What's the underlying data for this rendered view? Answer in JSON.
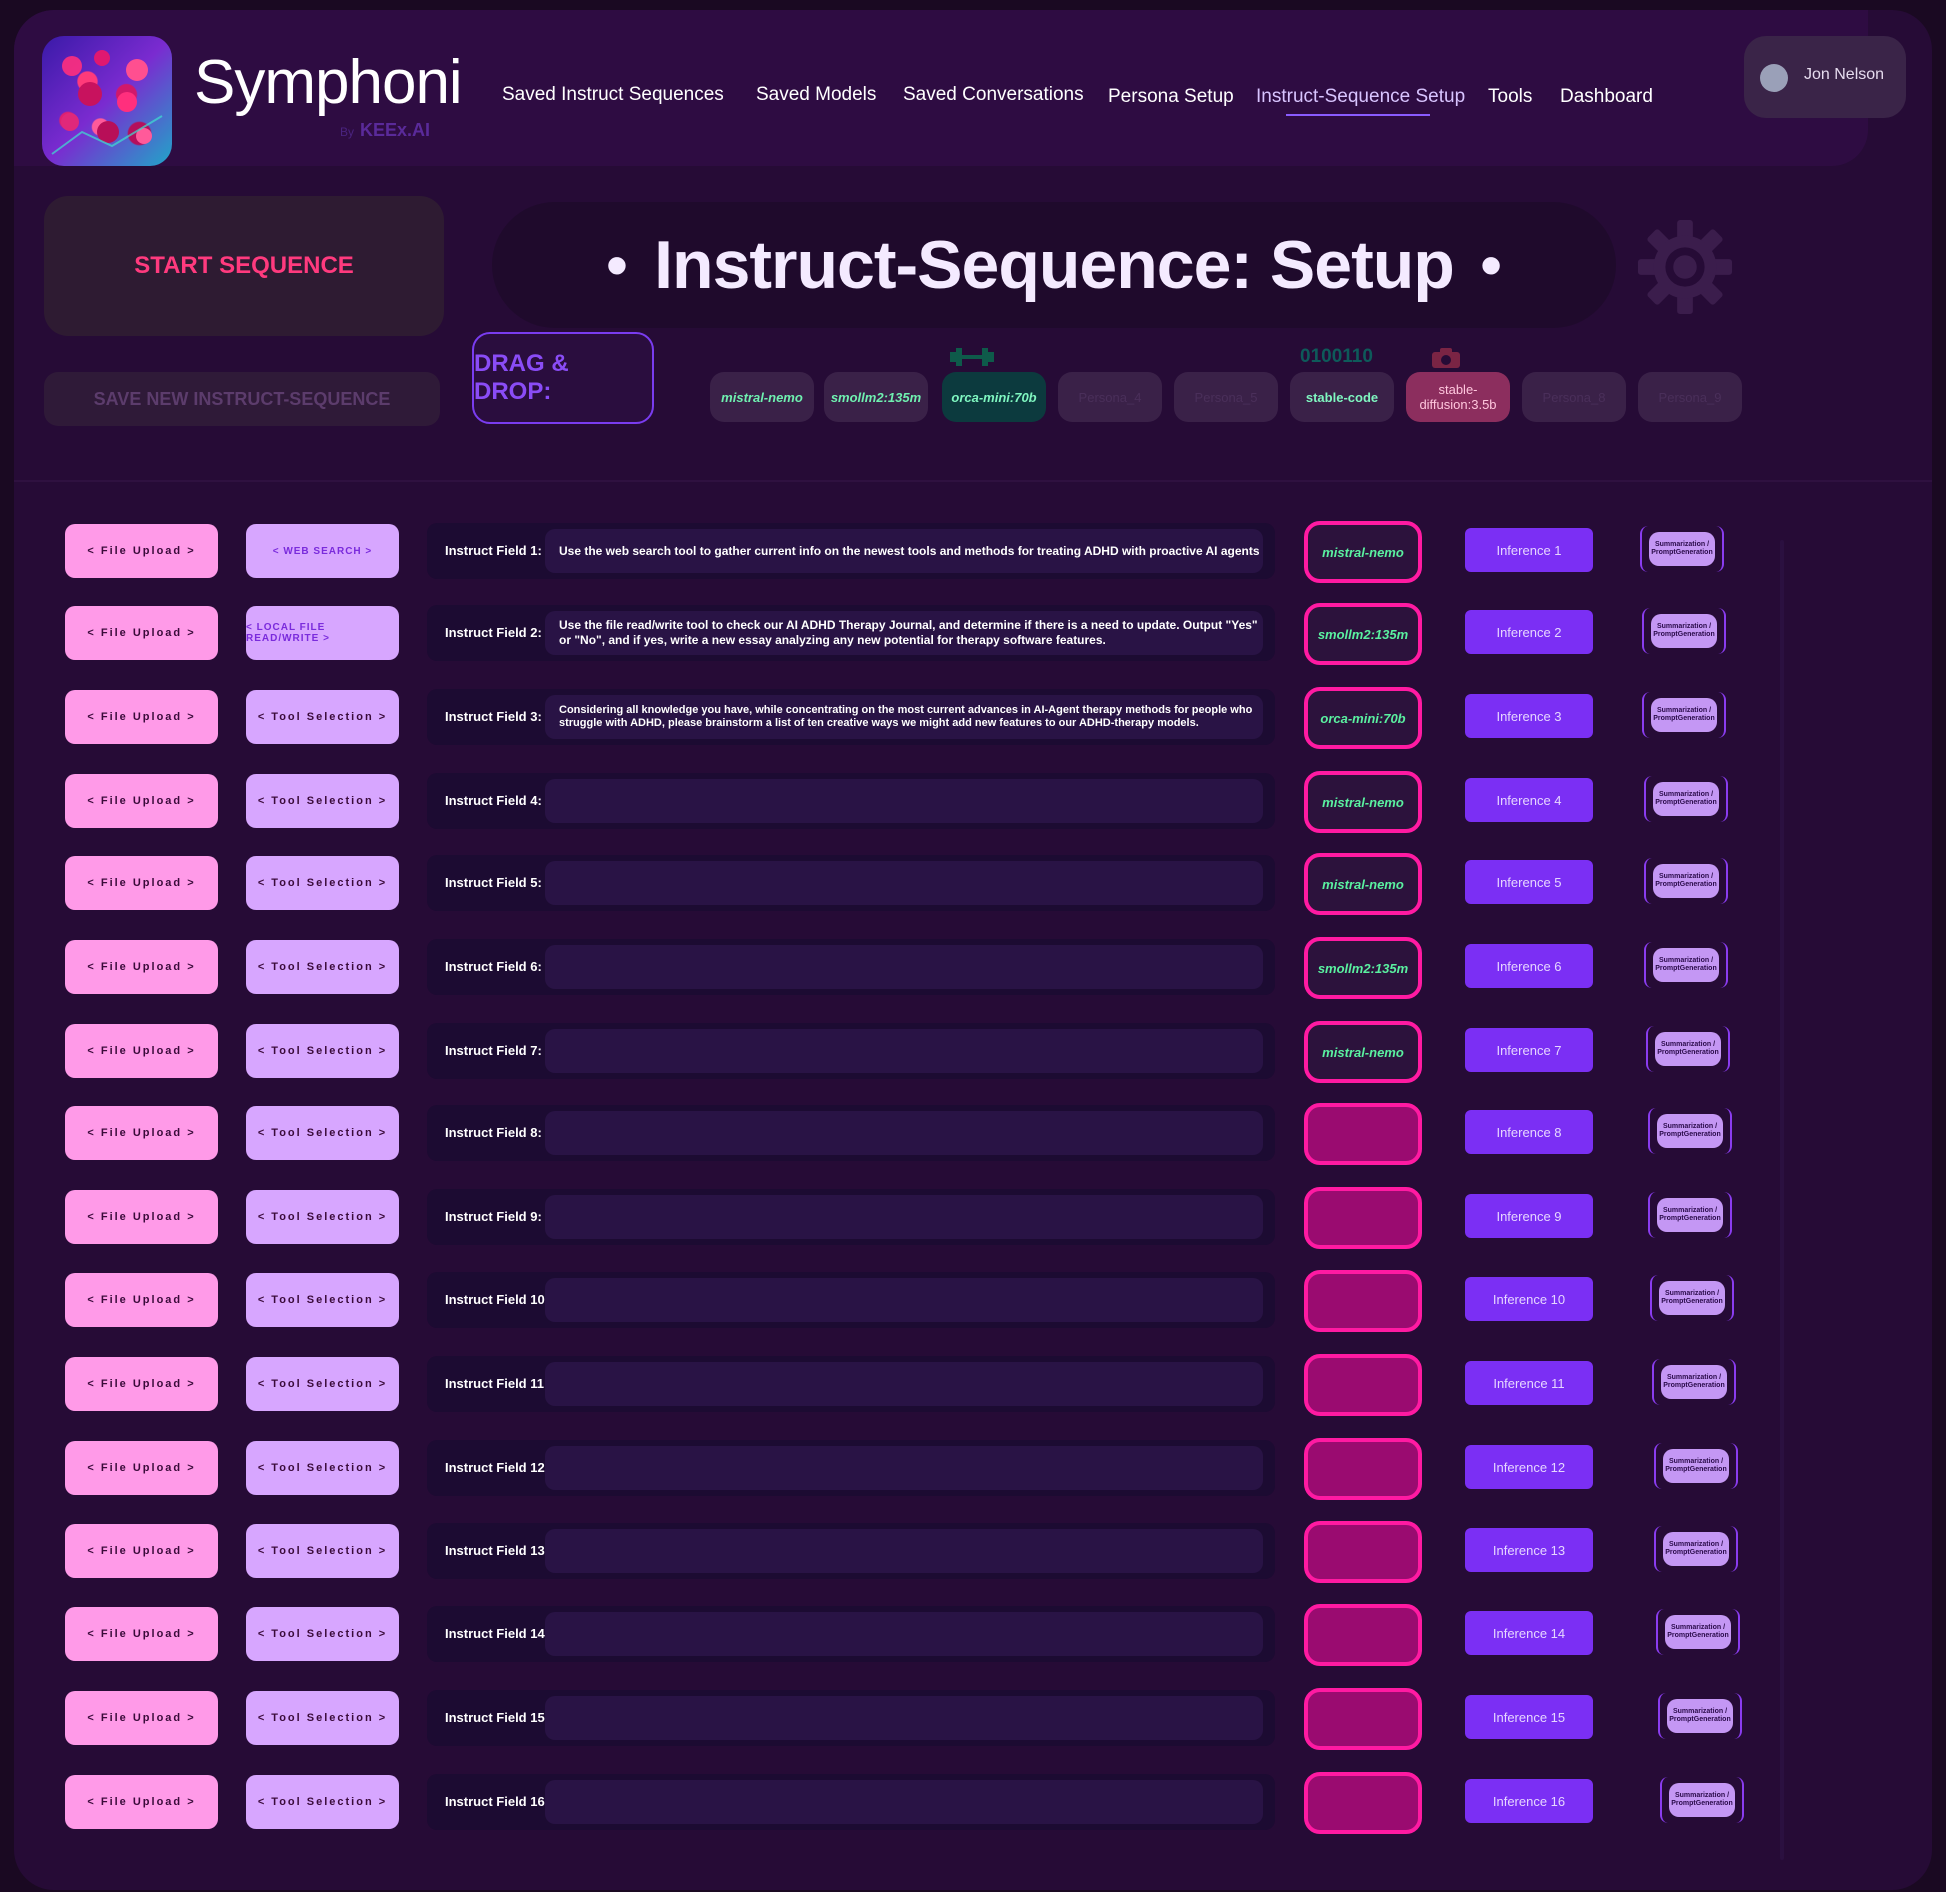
{
  "app": {
    "name": "Symphoni",
    "by": "By",
    "company": "KEEx.AI"
  },
  "nav": [
    {
      "label": "Saved Instruct Sequences"
    },
    {
      "label": "Saved Models"
    },
    {
      "label": "Saved Conversations"
    },
    {
      "label": "Persona Setup"
    },
    {
      "label": "Instruct-Sequence Setup",
      "active": true
    },
    {
      "label": "Tools"
    },
    {
      "label": "Dashboard"
    }
  ],
  "user": {
    "name": "Jon Nelson",
    "icon": "avatar-icon"
  },
  "controls": {
    "start_label": "START SEQUENCE",
    "save_label": "SAVE NEW INSTRUCT-SEQUENCE",
    "page_title": "Instruct-Sequence: Setup",
    "bullet": "•",
    "dnd_label": "DRAG & DROP:",
    "settings_icon": "gear-icon"
  },
  "chips": [
    {
      "label": "mistral-nemo"
    },
    {
      "label": "smollm2:135m"
    },
    {
      "label": "orca-mini:70b"
    },
    {
      "label": "Persona_4"
    },
    {
      "label": "Persona_5"
    },
    {
      "label": "stable-code",
      "badge": "0100110"
    },
    {
      "label": "stable-diffusion:3.5b"
    },
    {
      "label": "Persona_8"
    },
    {
      "label": "Persona_9"
    }
  ],
  "colors": {
    "background": "#260b36",
    "accent_pink": "#ff1aa2",
    "accent_purple": "#7b2ff4",
    "model_text": "#5af0a0"
  },
  "rows": [
    {
      "file": "< File Upload >",
      "tool": "<  WEB SEARCH  >",
      "label": "Instruct Field 1:",
      "text": "Use the web search tool to gather current info on the newest tools and methods for treating ADHD with proactive AI agents",
      "model": "mistral-nemo",
      "inference": "Inference 1",
      "summ": "Summarization / PromptGeneration"
    },
    {
      "file": "< File Upload >",
      "tool": "<  LOCAL FILE READ/WRITE  >",
      "label": "Instruct Field 2:",
      "text": "Use the file read/write tool to check our AI ADHD Therapy Journal, and determine if there is a need to update. Output \"Yes\" or \"No\", and if yes, write a new essay analyzing any new potential for therapy software features.",
      "model": "smollm2:135m",
      "inference": "Inference 2",
      "summ": "Summarization / PromptGeneration"
    },
    {
      "file": "< File Upload >",
      "tool": "< Tool Selection >",
      "label": "Instruct Field 3:",
      "text": "Considering all knowledge you have, while concentrating on the most current advances in AI-Agent therapy methods for people who struggle with ADHD, please brainstorm a list of ten creative ways we might add new features to our ADHD-therapy models.",
      "model": "orca-mini:70b",
      "inference": "Inference 3",
      "summ": "Summarization / PromptGeneration"
    },
    {
      "file": "< File Upload >",
      "tool": "< Tool Selection >",
      "label": "Instruct Field 4:",
      "text": "",
      "model": "mistral-nemo",
      "inference": "Inference 4",
      "summ": "Summarization / PromptGeneration"
    },
    {
      "file": "< File Upload >",
      "tool": "< Tool Selection >",
      "label": "Instruct Field 5:",
      "text": "",
      "model": "mistral-nemo",
      "inference": "Inference 5",
      "summ": "Summarization / PromptGeneration"
    },
    {
      "file": "< File Upload >",
      "tool": "< Tool Selection >",
      "label": "Instruct Field 6:",
      "text": "",
      "model": "smollm2:135m",
      "inference": "Inference 6",
      "summ": "Summarization / PromptGeneration"
    },
    {
      "file": "< File Upload >",
      "tool": "< Tool Selection >",
      "label": "Instruct Field 7:",
      "text": "",
      "model": "mistral-nemo",
      "inference": "Inference 7",
      "summ": "Summarization / PromptGeneration"
    },
    {
      "file": "< File Upload >",
      "tool": "< Tool Selection >",
      "label": "Instruct Field 8:",
      "text": "",
      "model": "",
      "inference": "Inference 8",
      "summ": "Summarization / PromptGeneration"
    },
    {
      "file": "< File Upload >",
      "tool": "< Tool Selection >",
      "label": "Instruct Field 9:",
      "text": "",
      "model": "",
      "inference": "Inference 9",
      "summ": "Summarization / PromptGeneration"
    },
    {
      "file": "< File Upload >",
      "tool": "< Tool Selection >",
      "label": "Instruct Field 10:",
      "text": "",
      "model": "",
      "inference": "Inference 10",
      "summ": "Summarization / PromptGeneration"
    },
    {
      "file": "< File Upload >",
      "tool": "< Tool Selection >",
      "label": "Instruct Field 11:",
      "text": "",
      "model": "",
      "inference": "Inference 11",
      "summ": "Summarization / PromptGeneration"
    },
    {
      "file": "< File Upload >",
      "tool": "< Tool Selection >",
      "label": "Instruct Field 12:",
      "text": "",
      "model": "",
      "inference": "Inference 12",
      "summ": "Summarization / PromptGeneration"
    },
    {
      "file": "< File Upload >",
      "tool": "< Tool Selection >",
      "label": "Instruct Field 13:",
      "text": "",
      "model": "",
      "inference": "Inference 13",
      "summ": "Summarization / PromptGeneration"
    },
    {
      "file": "< File Upload >",
      "tool": "< Tool Selection >",
      "label": "Instruct Field 14:",
      "text": "",
      "model": "",
      "inference": "Inference 14",
      "summ": "Summarization / PromptGeneration"
    },
    {
      "file": "< File Upload >",
      "tool": "< Tool Selection >",
      "label": "Instruct Field 15:",
      "text": "",
      "model": "",
      "inference": "Inference 15",
      "summ": "Summarization / PromptGeneration"
    },
    {
      "file": "< File Upload >",
      "tool": "< Tool Selection >",
      "label": "Instruct Field 16:",
      "text": "",
      "model": "",
      "inference": "Inference 16",
      "summ": "Summarization / PromptGeneration"
    }
  ]
}
